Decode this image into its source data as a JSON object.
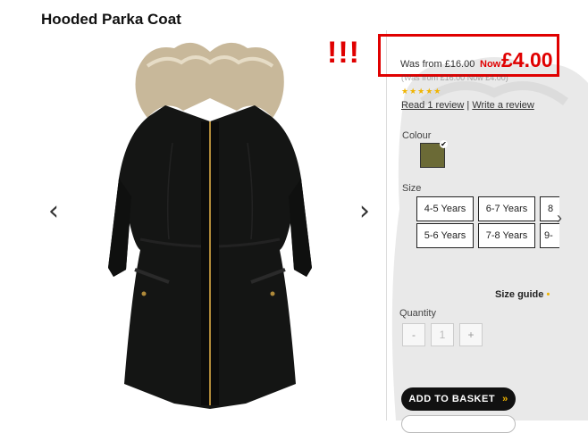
{
  "product": {
    "title": "Hooded Parka Coat"
  },
  "gallery": {
    "prev_icon": "chevron-left-icon",
    "next_icon": "chevron-right-icon",
    "prev_glyph": "‹",
    "next_glyph": "›"
  },
  "annotation": {
    "text": "!!!",
    "color": "#e00000"
  },
  "price": {
    "was": "Was from £16.00",
    "now_label": "Now",
    "now": "£4.00",
    "faint_line": "(Was from £16.00 Now £4.00)",
    "accent_color": "#e00000"
  },
  "rating": {
    "stars": "★★★★★",
    "read_review": "Read 1 review",
    "separator": "|",
    "write_review": "Write a review"
  },
  "colour": {
    "label": "Colour",
    "selected_swatch": "#6b6a36"
  },
  "size": {
    "label": "Size",
    "options": [
      "4-5 Years",
      "6-7 Years",
      "8",
      "5-6 Years",
      "7-8 Years",
      "9-"
    ],
    "next_glyph": "›"
  },
  "size_guide": {
    "label": "Size guide",
    "dot": "•"
  },
  "quantity": {
    "label": "Quantity",
    "minus": "-",
    "value": "1",
    "plus": "+"
  },
  "basket": {
    "label": "ADD TO BASKET",
    "chevron": "»"
  }
}
